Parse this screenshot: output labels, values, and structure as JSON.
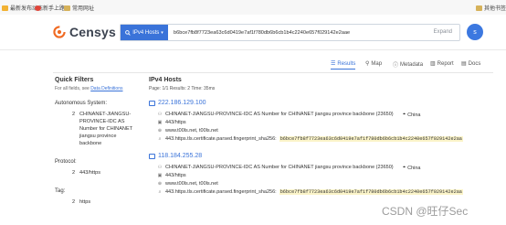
{
  "bookmarks": [
    {
      "label": "最新发布动态",
      "color": "#f2b233"
    },
    {
      "label": "新手上路",
      "color": "#e0453a"
    },
    {
      "label": "常用网址",
      "color": "#d6b25a"
    }
  ],
  "bookmarks_right": "其他书签",
  "header": {
    "logo_text": "Censys",
    "search_type": "IPv4 Hosts",
    "search_value": "b6bce7fb8f7723ea63c6d0419e7af1f780db6b6cb1b4c2240e657f029142e2aae",
    "expand_label": "Expand",
    "avatar_initial": "s"
  },
  "tabs": [
    {
      "label": "Results",
      "icon": "list-icon",
      "active": true
    },
    {
      "label": "Map",
      "icon": "pin-icon",
      "active": false
    },
    {
      "label": "Metadata",
      "icon": "info-icon",
      "active": false
    },
    {
      "label": "Report",
      "icon": "chart-icon",
      "active": false
    },
    {
      "label": "Docs",
      "icon": "book-icon",
      "active": false
    }
  ],
  "filters": {
    "title": "Quick Filters",
    "subtitle_prefix": "For all fields, see",
    "subtitle_link": "Data Definitions",
    "autonomous_label": "Autonomous System:",
    "autonomous_count": "2",
    "autonomous_value": "CHINANET-JIANGSU-PROVINCE-IDC AS Number for CHINANET jiangsu province backbone",
    "protocol_label": "Protocol:",
    "protocol_count": "2",
    "protocol_value": "443/https",
    "tag_label": "Tag:",
    "tag_count": "2",
    "tag_value": "https"
  },
  "results": {
    "title": "IPv4 Hosts",
    "meta": "Page: 1/1   Results: 2   Time: 35ms",
    "hosts": [
      {
        "ip": "222.186.129.100",
        "asn": "CHINANET-JIANGSU-PROVINCE-IDC AS Number for CHINANET jiangsu province backbone (23650)",
        "country": "China",
        "protocol": "443/https",
        "domain": "www.t00ls.net, t00ls.net",
        "field": "443.https.tls.certificate.parsed.fingerprint_sha256:",
        "hash": "b6bce7fb8f7723ea63c6d0419e7af1f780db6b6cb1b4c2240e657f029142e2aa"
      },
      {
        "ip": "118.184.255.28",
        "asn": "CHINANET-JIANGSU-PROVINCE-IDC AS Number for CHINANET jiangsu province backbone (23650)",
        "country": "China",
        "protocol": "443/https",
        "domain": "www.t00ls.net, t00ls.net",
        "field": "443.https.tls.certificate.parsed.fingerprint_sha256:",
        "hash": "b6bce7fb8f7723ea63c6d0419e7af1f780db6b6cb1b4c2240e657f029142e2aa"
      }
    ]
  },
  "watermark": "CSDN @旺仔Sec",
  "colors": {
    "accent": "#3a73d9",
    "logo": "#f06a22",
    "highlight": "#fbf4c9"
  }
}
